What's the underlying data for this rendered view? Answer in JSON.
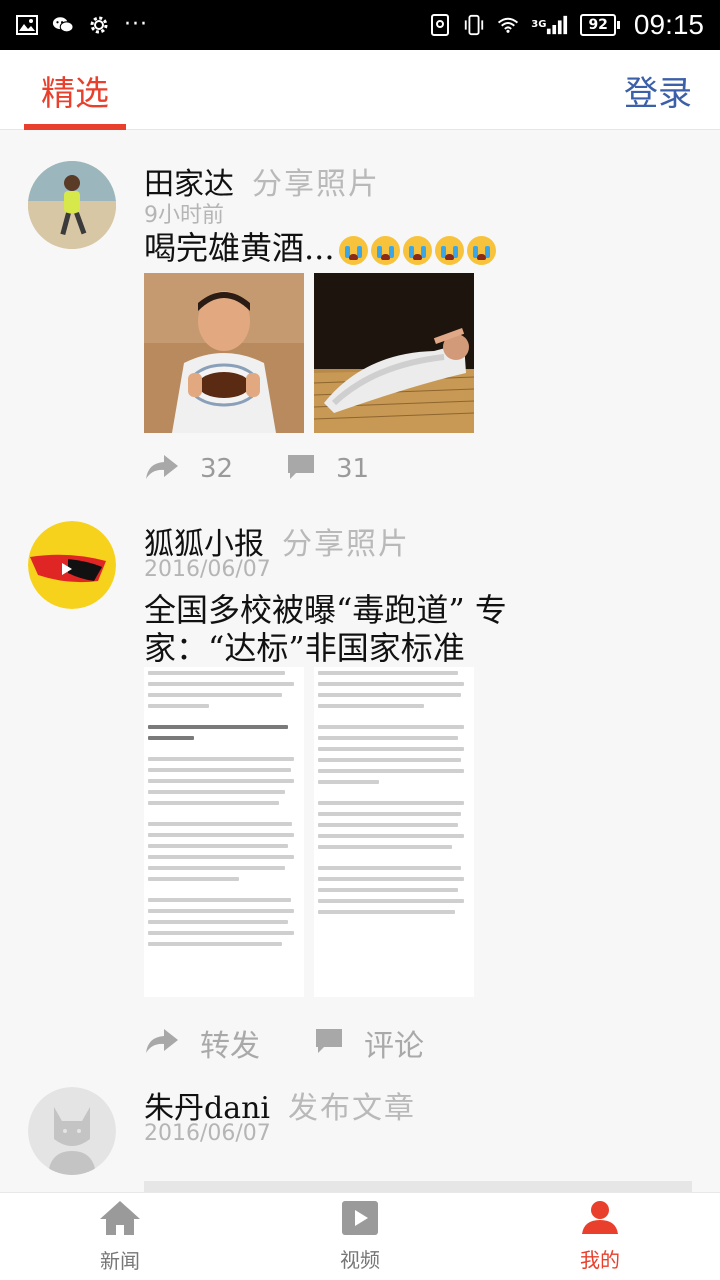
{
  "status_bar": {
    "network": "3G",
    "battery": "92",
    "time": "09:15",
    "icons": [
      "image-icon",
      "wechat-icon",
      "settings-icon",
      "more-icon",
      "screen-lock-icon",
      "vibrate-icon",
      "wifi-icon",
      "signal-icon"
    ]
  },
  "header": {
    "tab_featured": "精选",
    "login": "登录",
    "accent_color": "#e8402d",
    "link_color": "#3b5fa8"
  },
  "posts": [
    {
      "author": "田家达",
      "action": "分享照片",
      "time": "9小时前",
      "text": "喝完雄黄酒...",
      "emoji_count": 5,
      "share_count": "32",
      "comment_count": "31"
    },
    {
      "author": "狐狐小报",
      "action": "分享照片",
      "time": "2016/06/07",
      "text": "全国多校被曝“毒跑道” 专家：“达标”非国家标准",
      "share_label": "转发",
      "comment_label": "评论"
    },
    {
      "author": "朱丹dani",
      "action": "发布文章",
      "time": "2016/06/07"
    }
  ],
  "bottom_nav": [
    {
      "label": "新闻",
      "icon": "home-icon"
    },
    {
      "label": "视频",
      "icon": "video-icon"
    },
    {
      "label": "我的",
      "icon": "person-icon",
      "active": true
    }
  ]
}
